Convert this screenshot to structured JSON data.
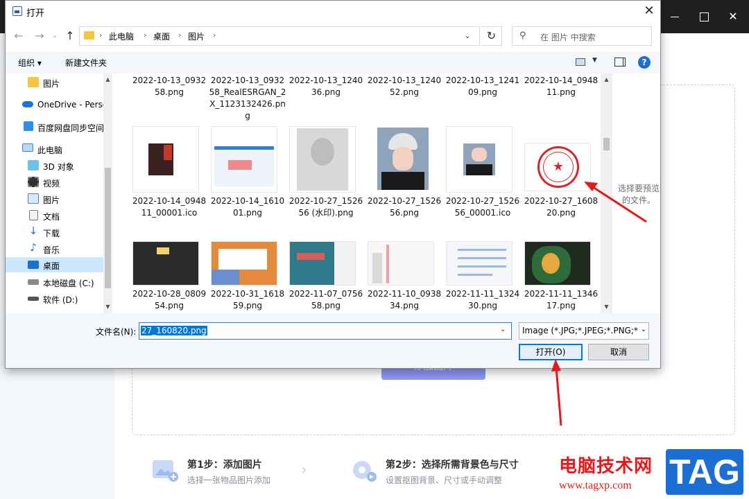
{
  "dialog": {
    "title": "打开",
    "close_label": "✕",
    "breadcrumbs": [
      "此电脑",
      "桌面",
      "图片"
    ],
    "search_placeholder": "在 图片 中搜索",
    "toolbar": {
      "organize": "组织 ▾",
      "new_folder": "新建文件夹",
      "help": "?"
    },
    "nav_items": [
      {
        "label": "图片",
        "icon": "folder-icon"
      },
      {
        "label": "OneDrive - Personal",
        "icon": "cloud-icon"
      },
      {
        "label": "百度网盘同步空间",
        "icon": "baidu-netdisk-icon"
      },
      {
        "label": "此电脑",
        "icon": "computer-icon"
      },
      {
        "label": "3D 对象",
        "icon": "3d-objects-icon"
      },
      {
        "label": "视频",
        "icon": "video-icon"
      },
      {
        "label": "图片",
        "icon": "pictures-icon"
      },
      {
        "label": "文档",
        "icon": "documents-icon"
      },
      {
        "label": "下载",
        "icon": "download-icon"
      },
      {
        "label": "音乐",
        "icon": "music-icon"
      },
      {
        "label": "桌面",
        "icon": "desktop-icon",
        "selected": true
      },
      {
        "label": "本地磁盘 (C:)",
        "icon": "drive-c-icon"
      },
      {
        "label": "软件 (D:)",
        "icon": "drive-d-icon"
      }
    ],
    "files_row0": [
      "2022-10-13_093258.png",
      "2022-10-13_093258_RealESRGAN_2X_1123132426.png",
      "2022-10-13_124036.png",
      "2022-10-13_124052.png",
      "2022-10-13_124109.png",
      "2022-10-14_094811.png"
    ],
    "files_row1": [
      "2022-10-14_094811_00001.ico",
      "2022-10-14_161001.png",
      "2022-10-27_152656 (水印).png",
      "2022-10-27_152656.png",
      "2022-10-27_152656_00001.ico",
      "2022-10-27_160820.png"
    ],
    "files_row2": [
      "2022-10-28_080954.png",
      "2022-10-31_161859.png",
      "2022-11-07_075658.png",
      "2022-11-10_093834.png",
      "2022-11-11_132430.png",
      "2022-11-11_134617.png"
    ],
    "preview_text": "选择要预览的文件。",
    "filename_label": "文件名(N):",
    "filename_value": "27_160820.png",
    "filetype_value": "Image (*.JPG;*.JPEG;*.PNG;*.BMP)",
    "open_button": "打开(O)",
    "cancel_button": "取消"
  },
  "background_app": {
    "add_image_button": "添加图片",
    "steps": [
      {
        "title": "第1步：添加图片",
        "desc": "选择一张物品图片添加"
      },
      {
        "title": "第2步：选择所需背景色与尺寸",
        "desc": "设置抠图背景、尺寸或手动调整"
      }
    ]
  },
  "watermark": {
    "text": "电脑技术网",
    "url": "www.tagxp.com",
    "tag": "TAG"
  },
  "colors": {
    "accent": "#0078d7",
    "selection": "#cce8ff",
    "annotation_red": "#e5191c",
    "primary_button": "#8c97f2"
  }
}
